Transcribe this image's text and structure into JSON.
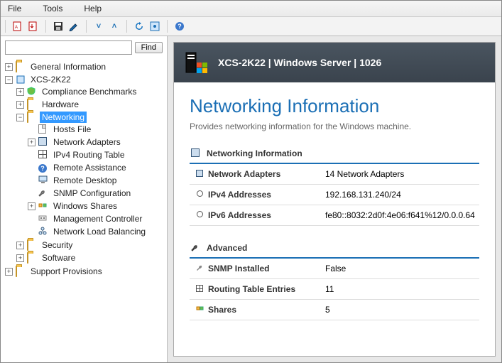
{
  "menubar": {
    "file": "File",
    "tools": "Tools",
    "help": "Help"
  },
  "search": {
    "placeholder": "",
    "find_label": "Find"
  },
  "tree": {
    "general_info": "General Information",
    "host": "XCS-2K22",
    "compliance": "Compliance Benchmarks",
    "hardware": "Hardware",
    "networking": "Networking",
    "hosts_file": "Hosts File",
    "network_adapters": "Network Adapters",
    "ipv4_routing": "IPv4 Routing Table",
    "remote_assistance": "Remote Assistance",
    "remote_desktop": "Remote Desktop",
    "snmp_config": "SNMP Configuration",
    "windows_shares": "Windows Shares",
    "mgmt_controller": "Management Controller",
    "nlb": "Network Load Balancing",
    "security": "Security",
    "software": "Software",
    "support": "Support Provisions"
  },
  "header": {
    "title": "XCS-2K22 | Windows Server | 1026"
  },
  "page": {
    "title": "Networking Information",
    "subtitle": "Provides networking information for the Windows machine."
  },
  "section1": {
    "title": "Networking Information",
    "rows": {
      "adapters_label": "Network Adapters",
      "adapters_value": "14 Network Adapters",
      "ipv4_label": "IPv4 Addresses",
      "ipv4_value": "192.168.131.240/24",
      "ipv6_label": "IPv6 Addresses",
      "ipv6_value": "fe80::8032:2d0f:4e06:f641%12/0.0.0.64"
    }
  },
  "section2": {
    "title": "Advanced",
    "rows": {
      "snmp_label": "SNMP Installed",
      "snmp_value": "False",
      "routing_label": "Routing Table Entries",
      "routing_value": "11",
      "shares_label": "Shares",
      "shares_value": "5"
    }
  }
}
